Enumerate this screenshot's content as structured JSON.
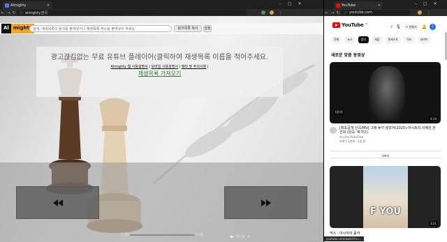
{
  "left_window": {
    "tab_title": "Almighty",
    "address": "almighty.한국",
    "logo_a": "Al",
    "logo_b": "mighty",
    "search_placeholder": "검색, 재생목록의 링크를 붙여넣거나 재생목록 주소를 붙여넣어 주세요.",
    "copy_button": "링크목록 복사",
    "settings_button": "설정",
    "notice_heading": "광고끊김없는 무료 유튜브 플레이어(클릭하여 재생목록 이름을 적어주세요.",
    "links": [
      "Almighty 웹 사용설명서",
      "모바일 사용설명서",
      "메타 및 주의사항"
    ],
    "fetch_playlist": "재생목록 가져오기",
    "time_current": "0:00",
    "time_total": "0:00"
  },
  "right_window": {
    "tab_title": "YouTube",
    "address": "youtube.com",
    "brand": "YouTube",
    "region": "KR",
    "create_label": "만들기",
    "avatar_letter": "J",
    "chips": [
      "전체",
      "뉴스",
      "음악",
      "게임",
      "팟캐스트",
      "믹스",
      "라이브"
    ],
    "active_chip": 2,
    "section_title": "새로운 맞춤 동영상",
    "video1": {
      "title": "[최초공개 신곡/MV] 그래 늦지 않았어(2025)-아시트리,이예은,한건희 (원곡: 박기다)",
      "channel": "아시트리 AshaTree",
      "stats": "조회수 1천회 · 2일 전",
      "duration": "4:14",
      "badge": "[음악]"
    },
    "more_label": "더보기",
    "video2": {
      "overlay_text": "F YOU",
      "duration": "3:21",
      "title": "믹스 - 아시아의 음악"
    },
    "status_url": "youtube.com/watch?v=..."
  },
  "colors": {
    "youtube_red": "#ff0000",
    "almighty_orange": "#f5a623",
    "fetch_green": "#1a8a1a",
    "avatar_blue": "#1a73e8"
  }
}
